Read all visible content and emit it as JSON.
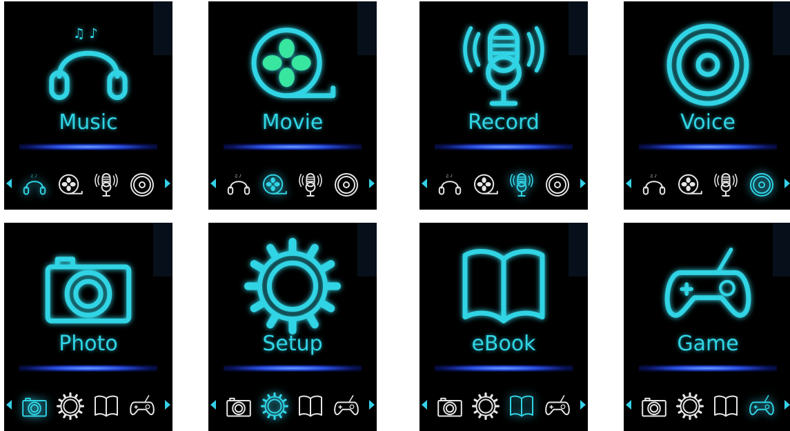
{
  "colors": {
    "accent": "#31d4e4",
    "inactive": "#e6e6e6",
    "background": "#000000",
    "bar": "#2a4fe0"
  },
  "screens": [
    {
      "title": "Music",
      "icon": "headphones-icon",
      "group": "media",
      "active_index": 0
    },
    {
      "title": "Movie",
      "icon": "film-reel-icon",
      "group": "media",
      "active_index": 1
    },
    {
      "title": "Record",
      "icon": "microphone-icon",
      "group": "media",
      "active_index": 2
    },
    {
      "title": "Voice",
      "icon": "speaker-icon",
      "group": "media",
      "active_index": 3
    },
    {
      "title": "Photo",
      "icon": "camera-icon",
      "group": "tools",
      "active_index": 0
    },
    {
      "title": "Setup",
      "icon": "gear-icon",
      "group": "tools",
      "active_index": 1
    },
    {
      "title": "eBook",
      "icon": "book-icon",
      "group": "tools",
      "active_index": 2
    },
    {
      "title": "Game",
      "icon": "gamepad-icon",
      "group": "tools",
      "active_index": 3
    }
  ],
  "groups": {
    "media": [
      "headphones-icon",
      "film-reel-icon",
      "microphone-icon",
      "speaker-icon"
    ],
    "tools": [
      "camera-icon",
      "gear-icon",
      "book-icon",
      "gamepad-icon"
    ]
  }
}
